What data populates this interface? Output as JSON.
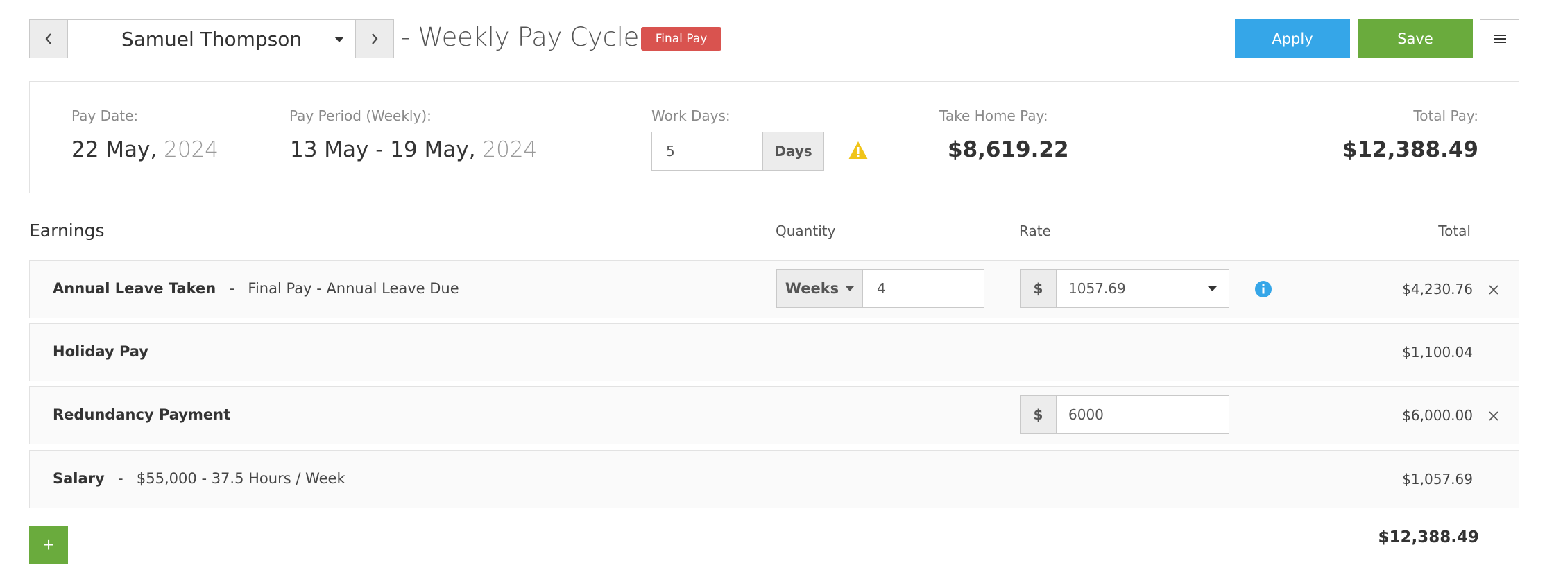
{
  "header": {
    "employee_name": "Samuel Thompson",
    "cycle_title": "- Weekly Pay Cycle",
    "badge": "Final Pay",
    "apply_label": "Apply",
    "save_label": "Save",
    "prev_icon": "chevron-left-icon",
    "next_icon": "chevron-right-icon",
    "menu_icon": "hamburger-menu-icon",
    "colors": {
      "apply": "#35a6e8",
      "save": "#6aab3d",
      "badge": "#d9534f"
    }
  },
  "summary": {
    "pay_date_label": "Pay Date:",
    "pay_date_day": "22 May,",
    "pay_date_year": "2024",
    "pay_period_label": "Pay Period (Weekly):",
    "pay_period_range": "13 May - 19 May,",
    "pay_period_year": "2024",
    "work_days_label": "Work Days:",
    "work_days_value": "5",
    "work_days_unit": "Days",
    "take_home_label": "Take Home Pay:",
    "take_home_value": "$8,619.22",
    "total_pay_label": "Total Pay:",
    "total_pay_value": "$12,388.49",
    "warning_color": "#f0c419"
  },
  "earnings": {
    "title": "Earnings",
    "col_quantity": "Quantity",
    "col_rate": "Rate",
    "col_total": "Total",
    "rows": [
      {
        "name": "Annual Leave Taken",
        "separator": "-",
        "description": "Final Pay - Annual Leave Due",
        "quantity_unit": "Weeks",
        "quantity": "4",
        "rate_prefix": "$",
        "rate": "1057.69",
        "total": "$4,230.76"
      },
      {
        "name": "Holiday Pay",
        "total": "$1,100.04"
      },
      {
        "name": "Redundancy Payment",
        "rate_prefix": "$",
        "rate": "6000",
        "total": "$6,000.00"
      },
      {
        "name": "Salary",
        "separator": "-",
        "description": "$55,000 - 37.5 Hours / Week",
        "total": "$1,057.69"
      }
    ],
    "add_label": "+",
    "grand_total": "$12,388.49"
  }
}
